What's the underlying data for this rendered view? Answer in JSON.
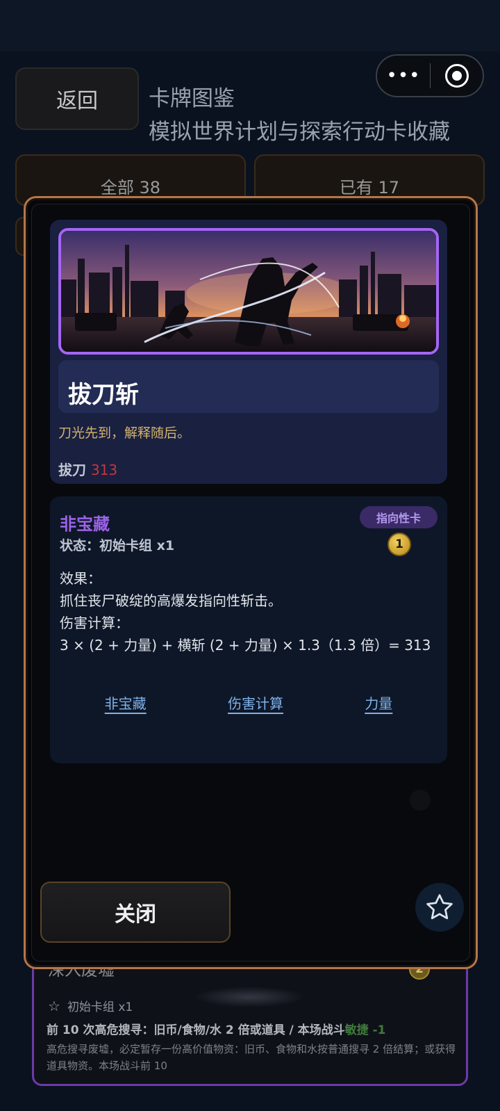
{
  "header": {
    "back_label": "返回",
    "title": "卡牌图鉴",
    "subtitle": "模拟世界计划与探索行动卡收藏",
    "capsule_more": "•••"
  },
  "tabs": [
    {
      "label": "全部 38"
    },
    {
      "label": "已有 17"
    }
  ],
  "background_card": {
    "title": "深入废墟",
    "cost": "2",
    "status": "初始卡组 x1",
    "effect_main": "前 10 次高危搜寻：旧币/食物/水 2 倍或道具 / 本场战斗",
    "effect_green": "敏捷 -1",
    "desc": "高危搜寻废墟，必定暂存一份高价值物资：旧币、食物和水按普通搜寻 2 倍结算；或获得道具物资。本场战斗前 10"
  },
  "modal": {
    "card_name": "拔刀斩",
    "flavor": "刀光先到，解释随后。",
    "stat_label": "拔刀",
    "stat_value": "313",
    "rarity": "非宝藏",
    "state": "状态：初始卡组 x1",
    "type": "指向性卡",
    "cost": "1",
    "effect_label": "效果：",
    "effect_text": "抓住丧尸破绽的高爆发指向性斩击。",
    "calc_label": "伤害计算：",
    "calc_text": "3 × (2 + 力量) + 横斩 (2 + 力量) × 1.3（1.3 倍）= 313",
    "links": [
      "非宝藏",
      "伤害计算",
      "力量"
    ],
    "close_label": "关闭",
    "colors": {
      "frame": "#b5764a",
      "art_border": "#a565f5",
      "accent_purple": "#9a62e6",
      "stat_red": "#c7363d",
      "flavor_gold": "#d3b36e",
      "link_blue": "#7fb3ea"
    }
  }
}
